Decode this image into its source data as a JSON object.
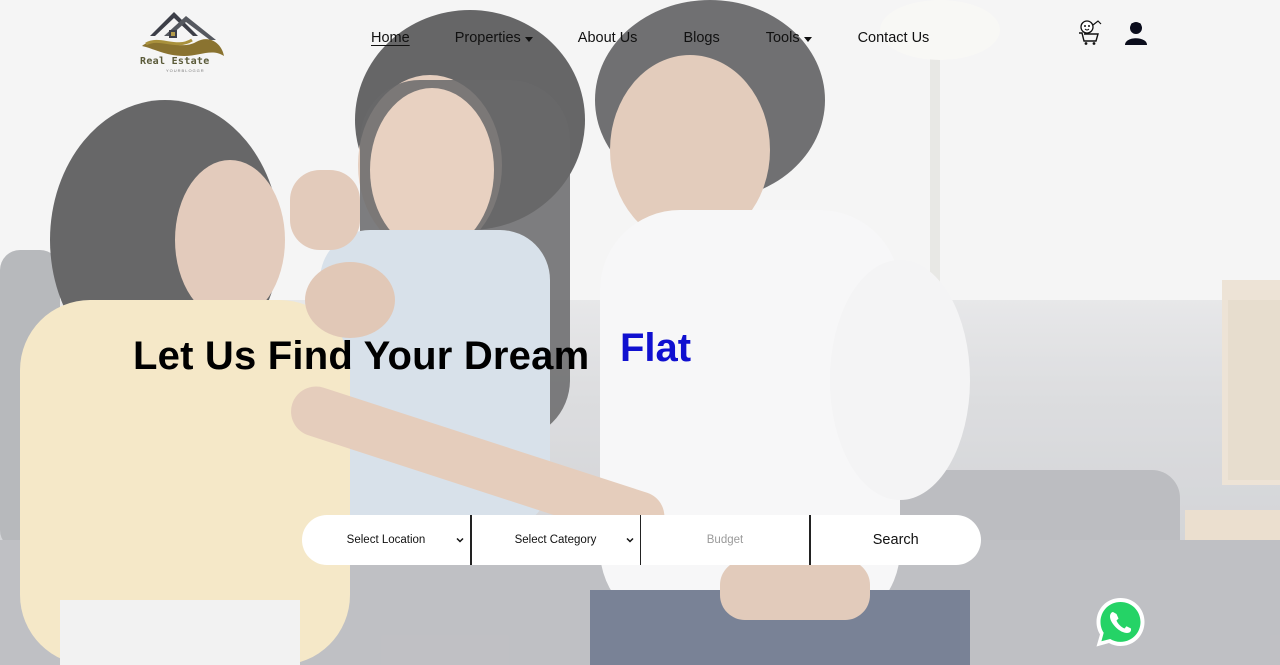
{
  "brand": {
    "logo_text": "Real Estate",
    "logo_subtext": "YOURBLOGGR"
  },
  "nav": {
    "items": [
      {
        "label": "Home",
        "active": true,
        "has_dropdown": false
      },
      {
        "label": "Properties",
        "active": false,
        "has_dropdown": true
      },
      {
        "label": "About Us",
        "active": false,
        "has_dropdown": false
      },
      {
        "label": "Blogs",
        "active": false,
        "has_dropdown": false
      },
      {
        "label": "Tools",
        "active": false,
        "has_dropdown": true
      },
      {
        "label": "Contact Us",
        "active": false,
        "has_dropdown": false
      }
    ]
  },
  "header_icons": {
    "cart": "cart-icon",
    "user": "user-icon"
  },
  "hero": {
    "headline": "Let Us Find Your Dream",
    "headline_accent": "Flat",
    "accent_color": "#1010d0"
  },
  "search": {
    "location_selected": "Select Location",
    "category_selected": "Select Category",
    "budget_placeholder": "Budget",
    "search_label": "Search"
  },
  "floating": {
    "whatsapp_icon": "whatsapp-icon",
    "whatsapp_color": "#25d366"
  }
}
